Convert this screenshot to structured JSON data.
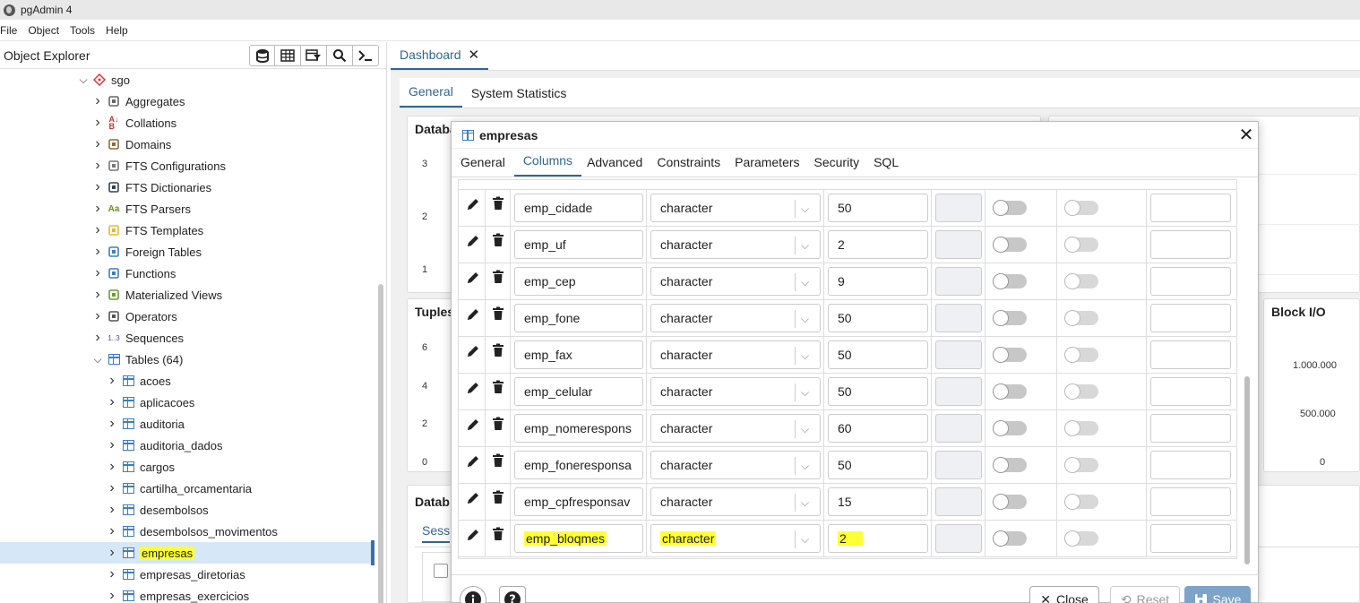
{
  "window": {
    "title": "pgAdmin 4"
  },
  "menu": [
    "File",
    "Object",
    "Tools",
    "Help"
  ],
  "explorer": {
    "title": "Object Explorer",
    "tree": [
      {
        "label": "sgo",
        "indent": 88,
        "icon": "database-icon",
        "expanded": true
      },
      {
        "label": "Aggregates",
        "indent": 104,
        "icon": "aggregates-icon"
      },
      {
        "label": "Collations",
        "indent": 104,
        "icon": "collations-icon"
      },
      {
        "label": "Domains",
        "indent": 104,
        "icon": "domains-icon"
      },
      {
        "label": "FTS Configurations",
        "indent": 104,
        "icon": "fts-config-icon"
      },
      {
        "label": "FTS Dictionaries",
        "indent": 104,
        "icon": "fts-dictionary-icon"
      },
      {
        "label": "FTS Parsers",
        "indent": 104,
        "icon": "fts-parser-icon"
      },
      {
        "label": "FTS Templates",
        "indent": 104,
        "icon": "fts-template-icon"
      },
      {
        "label": "Foreign Tables",
        "indent": 104,
        "icon": "foreign-table-icon"
      },
      {
        "label": "Functions",
        "indent": 104,
        "icon": "function-icon"
      },
      {
        "label": "Materialized Views",
        "indent": 104,
        "icon": "mview-icon"
      },
      {
        "label": "Operators",
        "indent": 104,
        "icon": "operator-icon"
      },
      {
        "label": "Sequences",
        "indent": 104,
        "icon": "sequence-icon"
      },
      {
        "label": "Tables (64)",
        "indent": 104,
        "icon": "tables-icon",
        "expanded": true
      },
      {
        "label": "acoes",
        "indent": 120,
        "icon": "table-icon"
      },
      {
        "label": "aplicacoes",
        "indent": 120,
        "icon": "table-icon"
      },
      {
        "label": "auditoria",
        "indent": 120,
        "icon": "table-icon"
      },
      {
        "label": "auditoria_dados",
        "indent": 120,
        "icon": "table-icon"
      },
      {
        "label": "cargos",
        "indent": 120,
        "icon": "table-icon"
      },
      {
        "label": "cartilha_orcamentaria",
        "indent": 120,
        "icon": "table-icon"
      },
      {
        "label": "desembolsos",
        "indent": 120,
        "icon": "table-icon"
      },
      {
        "label": "desembolsos_movimentos",
        "indent": 120,
        "icon": "table-icon"
      },
      {
        "label": "empresas",
        "indent": 120,
        "icon": "table-icon",
        "selected": true,
        "highlight": true
      },
      {
        "label": "empresas_diretorias",
        "indent": 120,
        "icon": "table-icon"
      },
      {
        "label": "empresas_exercicios",
        "indent": 120,
        "icon": "table-icon"
      }
    ]
  },
  "dashboard": {
    "tab": "Dashboard",
    "subtabs": [
      "General",
      "System Statistics"
    ],
    "cards": {
      "sessions_title": "Databa",
      "tuples_title": "Tuples",
      "block_io_title": "Block I/O",
      "activity_title": "Datab",
      "activity_tab": "Sess",
      "sessions_ticks": [
        "3",
        "2",
        "1"
      ],
      "tuples_ticks": [
        "6",
        "4",
        "2",
        "0"
      ],
      "block_ticks": [
        "1.000.000",
        "500.000",
        "0"
      ]
    }
  },
  "dialog": {
    "title": "empresas",
    "tabs": [
      "General",
      "Columns",
      "Advanced",
      "Constraints",
      "Parameters",
      "Security",
      "SQL"
    ],
    "active_tab": "Columns",
    "columns": [
      {
        "name": "emp_cidade",
        "type": "character",
        "length": "50"
      },
      {
        "name": "emp_uf",
        "type": "character",
        "length": "2"
      },
      {
        "name": "emp_cep",
        "type": "character",
        "length": "9"
      },
      {
        "name": "emp_fone",
        "type": "character",
        "length": "50"
      },
      {
        "name": "emp_fax",
        "type": "character",
        "length": "50"
      },
      {
        "name": "emp_celular",
        "type": "character",
        "length": "50"
      },
      {
        "name": "emp_nomerespons",
        "type": "character",
        "length": "60"
      },
      {
        "name": "emp_foneresponsa",
        "type": "character",
        "length": "50"
      },
      {
        "name": "emp_cpfresponsav",
        "type": "character",
        "length": "15"
      },
      {
        "name": "emp_bloqmes",
        "type": "character",
        "length": "2",
        "highlight": true
      }
    ],
    "footer": {
      "close": "Close",
      "reset": "Reset",
      "save": "Save"
    }
  }
}
